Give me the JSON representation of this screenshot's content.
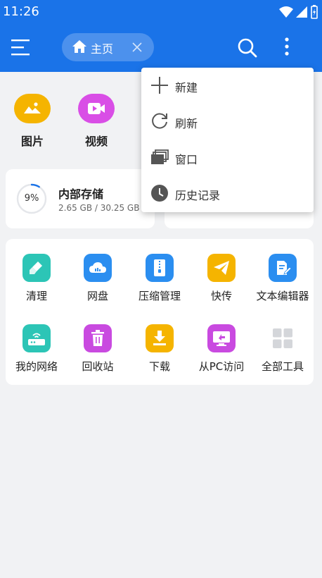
{
  "status_bar": {
    "time": "11:26"
  },
  "app_bar": {
    "home_tab_label": "主页"
  },
  "shortcuts": [
    {
      "label": "图片",
      "icon": "image-icon",
      "color": "#f5b400"
    },
    {
      "label": "视频",
      "icon": "video-icon",
      "color": "#d94ee6"
    }
  ],
  "storage": {
    "title": "内部存储",
    "usage": "2.65 GB / 30.25 GB",
    "percent_label": "9%",
    "percent": 9
  },
  "tools": [
    {
      "label": "清理",
      "icon": "broom-icon",
      "color": "#2cc5b6"
    },
    {
      "label": "网盘",
      "icon": "cloud-icon",
      "color": "#2b8ef0"
    },
    {
      "label": "压缩管理",
      "icon": "zip-icon",
      "color": "#2b8ef0"
    },
    {
      "label": "快传",
      "icon": "send-icon",
      "color": "#f5b400"
    },
    {
      "label": "文本编辑器",
      "icon": "document-edit-icon",
      "color": "#2b8ef0"
    },
    {
      "label": "我的网络",
      "icon": "router-icon",
      "color": "#2cc5b6"
    },
    {
      "label": "回收站",
      "icon": "trash-icon",
      "color": "#c94ae0"
    },
    {
      "label": "下载",
      "icon": "download-icon",
      "color": "#f5b400"
    },
    {
      "label": "从PC访问",
      "icon": "pc-access-icon",
      "color": "#c94ae0"
    },
    {
      "label": "全部工具",
      "icon": "grid-icon",
      "color": "#d4d6da"
    }
  ],
  "popup_menu": {
    "items": [
      {
        "label": "新建",
        "icon": "plus-icon"
      },
      {
        "label": "刷新",
        "icon": "refresh-icon"
      },
      {
        "label": "窗口",
        "icon": "windows-icon"
      },
      {
        "label": "历史记录",
        "icon": "history-icon"
      }
    ]
  },
  "colors": {
    "primary": "#1a73e8",
    "background": "#f1f2f4"
  }
}
